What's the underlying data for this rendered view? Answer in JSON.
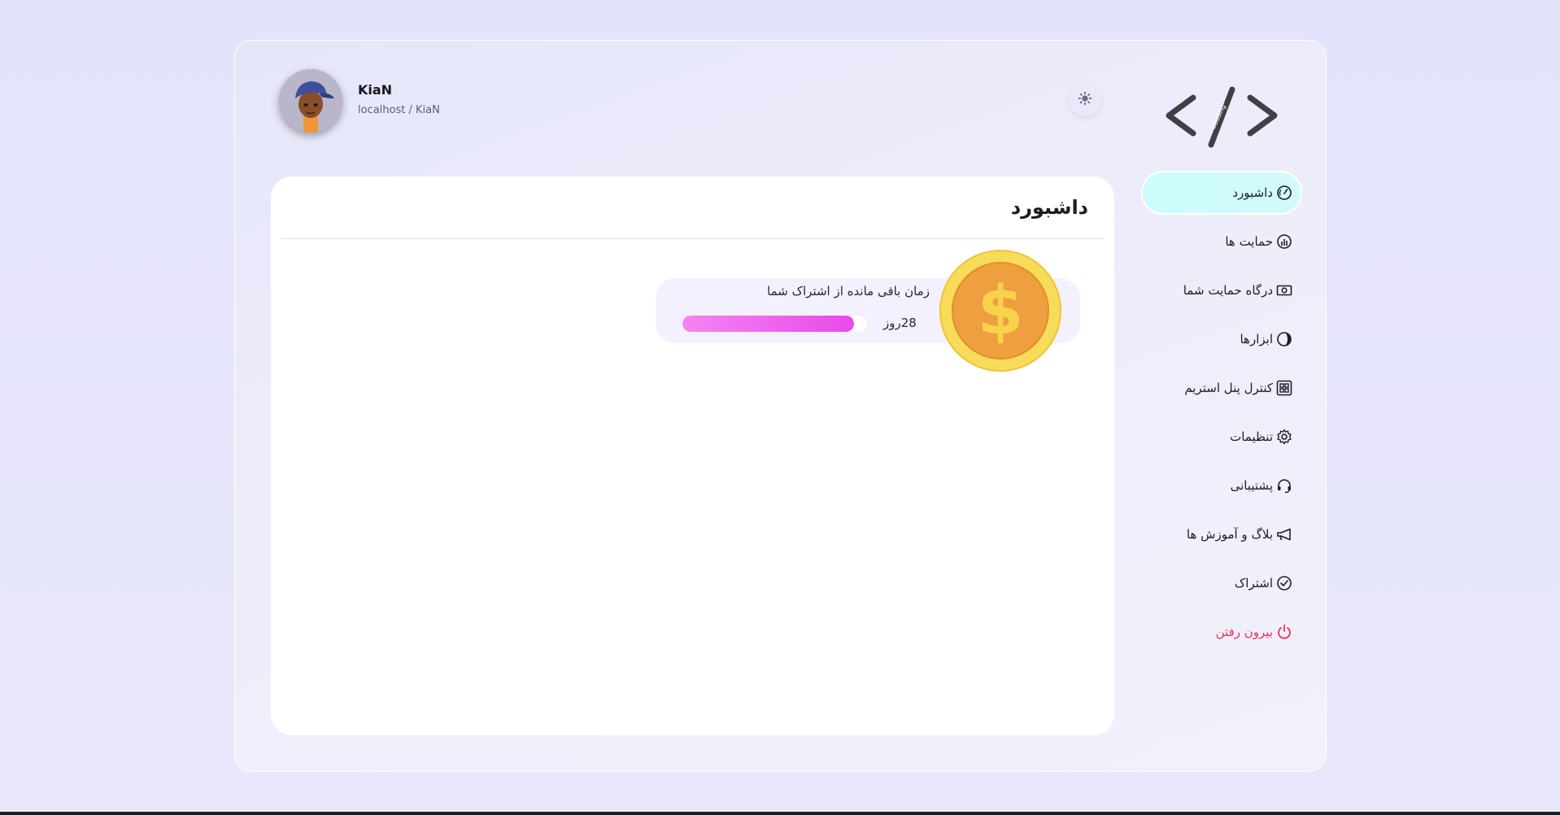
{
  "user": {
    "name": "KiaN",
    "path": "localhost / KiaN"
  },
  "brand": {
    "logo_text": "Codding"
  },
  "nav": {
    "items": [
      {
        "label": "داشبورد",
        "icon": "speedometer-icon"
      },
      {
        "label": "حمایت ها",
        "icon": "chart-icon"
      },
      {
        "label": "درگاه حمایت شما",
        "icon": "cash-icon"
      },
      {
        "label": "ابزارها",
        "icon": "tools-icon"
      },
      {
        "label": "کنترل پنل استریم",
        "icon": "grid-icon"
      },
      {
        "label": "تنظیمات",
        "icon": "gear-icon"
      },
      {
        "label": "پشتیبانی",
        "icon": "headset-icon"
      },
      {
        "label": "بلاگ و آموزش ها",
        "icon": "megaphone-icon"
      },
      {
        "label": "اشتراک",
        "icon": "check-circle-icon"
      },
      {
        "label": "بیرون رفتن",
        "icon": "power-icon"
      }
    ]
  },
  "main": {
    "title": "داشبورد",
    "subscription": {
      "title": "زمان باقی مانده از اشتراک شما",
      "days_label": "28روز",
      "progress": 0.93
    }
  },
  "colors": {
    "accent_active": "#ccfcfc",
    "danger": "#f02e55",
    "progress": "#e84ae7",
    "coin": "#f4c63a"
  }
}
